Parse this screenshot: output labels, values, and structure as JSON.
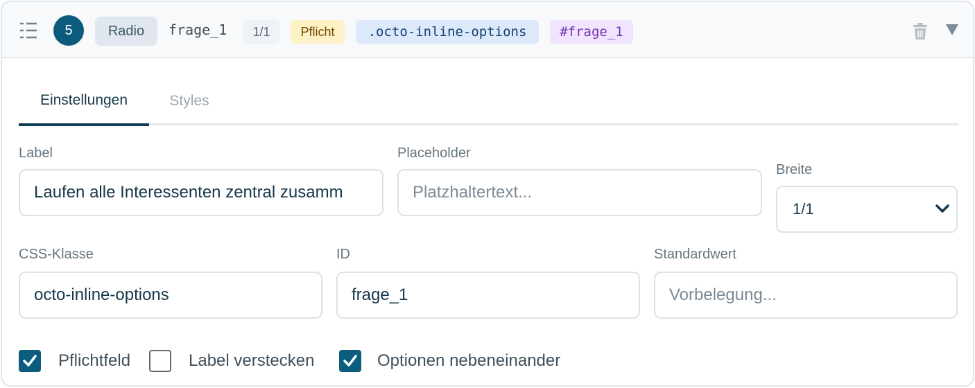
{
  "header": {
    "number": "5",
    "type": "Radio",
    "field_name": "frage_1",
    "width_badge": "1/1",
    "required_badge": "Pflicht",
    "class_badge": ".octo-inline-options",
    "id_badge": "#frage_1"
  },
  "tabs": [
    {
      "label": "Einstellungen",
      "active": true
    },
    {
      "label": "Styles",
      "active": false
    }
  ],
  "fields": {
    "label": {
      "label": "Label",
      "value": "Laufen alle Interessenten zentral zusamm"
    },
    "placeholder": {
      "label": "Placeholder",
      "value": "",
      "placeholder": "Platzhaltertext..."
    },
    "width": {
      "label": "Breite",
      "value": "1/1"
    },
    "css_class": {
      "label": "CSS-Klasse",
      "value": "octo-inline-options"
    },
    "id": {
      "label": "ID",
      "value": "frage_1"
    },
    "default": {
      "label": "Standardwert",
      "value": "",
      "placeholder": "Vorbelegung..."
    }
  },
  "checkboxes": [
    {
      "label": "Pflichtfeld",
      "checked": true
    },
    {
      "label": "Label verstecken",
      "checked": false
    },
    {
      "label": "Optionen nebeneinander",
      "checked": true
    }
  ],
  "colors": {
    "accent": "#0d5b7c",
    "required_bg": "#fdf1c6",
    "class_bg": "#dbe9fb",
    "id_bg": "#f1e4fd"
  },
  "icons": [
    "drag-handle-icon",
    "trash-icon",
    "collapse-triangle-icon",
    "chevron-down-icon",
    "checkmark-icon"
  ]
}
